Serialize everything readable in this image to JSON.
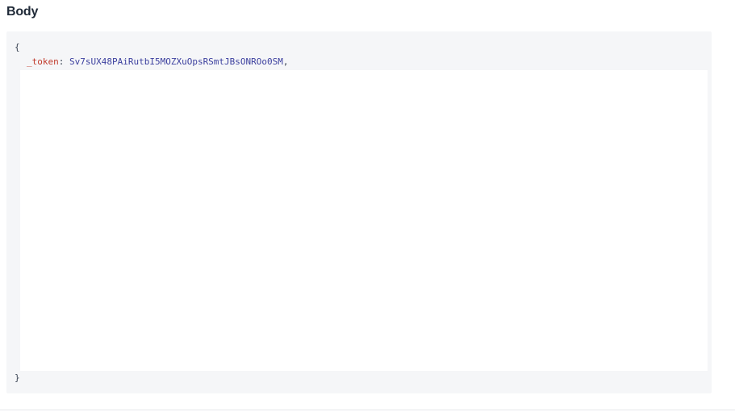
{
  "section": {
    "title": "Body"
  },
  "code": {
    "open_brace": "{",
    "close_brace": "}",
    "entries": [
      {
        "key": "_token",
        "colon": ":",
        "value": "Sv7sUX48PAiRutbI5MOZXuOpsRSmtJBsONROo0SM",
        "comma": ","
      }
    ]
  },
  "colors": {
    "key": "#c0392b",
    "value": "#3b3f9e",
    "code_background": "#f5f6f8"
  }
}
